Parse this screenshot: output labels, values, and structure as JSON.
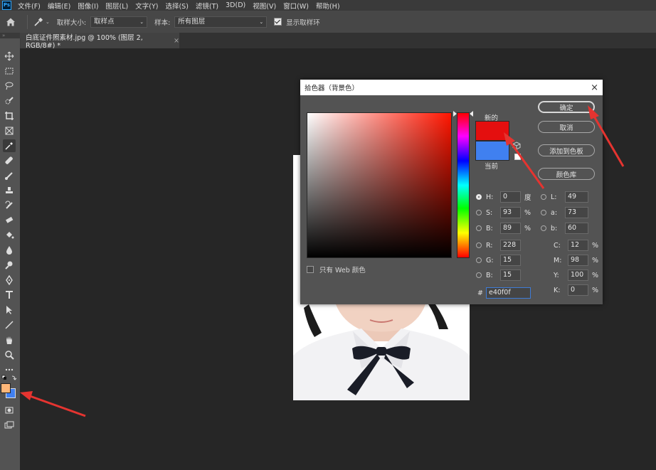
{
  "app": {
    "logo": "Ps"
  },
  "menubar": {
    "items": [
      "文件(F)",
      "编辑(E)",
      "图像(I)",
      "图层(L)",
      "文字(Y)",
      "选择(S)",
      "滤镜(T)",
      "3D(D)",
      "视图(V)",
      "窗口(W)",
      "帮助(H)"
    ]
  },
  "options": {
    "sample_size_label": "取样大小:",
    "sample_size_value": "取样点",
    "sample_label": "样本:",
    "sample_value": "所有图层",
    "show_ring_label": "显示取样环"
  },
  "document_tab": {
    "title": "白底证件照素材.jpg @ 100% (图层 2, RGB/8#) *",
    "close": "×"
  },
  "colors": {
    "foreground": "#ffb779",
    "background": "#4080f0",
    "new": "#e40f0f",
    "current": "#4080f0"
  },
  "dialog": {
    "title": "拾色器（背景色）",
    "close": "×",
    "new_label": "新的",
    "current_label": "当前",
    "web_only_label": "只有 Web 颜色",
    "buttons": {
      "ok": "确定",
      "cancel": "取消",
      "add_swatch": "添加到色板",
      "color_library": "颜色库"
    },
    "hsb": [
      {
        "label": "H:",
        "value": "0",
        "unit": "度",
        "selected": true
      },
      {
        "label": "S:",
        "value": "93",
        "unit": "%",
        "selected": false
      },
      {
        "label": "B:",
        "value": "89",
        "unit": "%",
        "selected": false
      }
    ],
    "rgb": [
      {
        "label": "R:",
        "value": "228"
      },
      {
        "label": "G:",
        "value": "15"
      },
      {
        "label": "B:",
        "value": "15"
      }
    ],
    "lab": [
      {
        "label": "L:",
        "value": "49"
      },
      {
        "label": "a:",
        "value": "73"
      },
      {
        "label": "b:",
        "value": "60"
      }
    ],
    "cmyk": [
      {
        "label": "C:",
        "value": "12",
        "unit": "%"
      },
      {
        "label": "M:",
        "value": "98",
        "unit": "%"
      },
      {
        "label": "Y:",
        "value": "100",
        "unit": "%"
      },
      {
        "label": "K:",
        "value": "0",
        "unit": "%"
      }
    ],
    "hex_label": "#",
    "hex_value": "e40f0f"
  }
}
